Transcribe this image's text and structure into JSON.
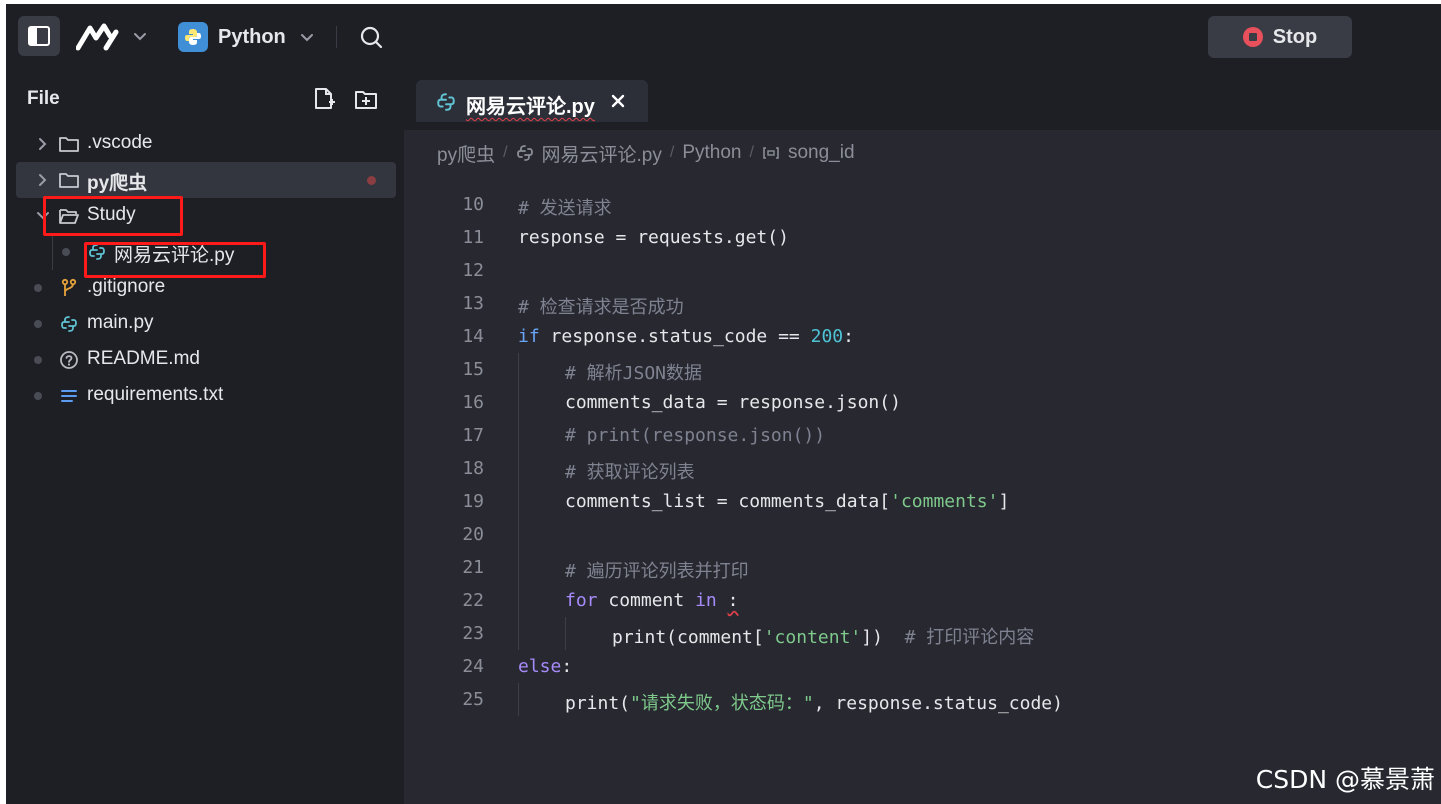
{
  "topbar": {
    "language": "Python",
    "stop_label": "Stop",
    "accent_stop": "#e8505b"
  },
  "sidebar": {
    "title": "File",
    "items": [
      {
        "label": ".vscode",
        "type": "folder",
        "expanded": false
      },
      {
        "label": "py爬虫",
        "type": "folder",
        "expanded": false,
        "active": true,
        "modified": true
      },
      {
        "label": "Study",
        "type": "folder",
        "expanded": true,
        "highlighted": true
      },
      {
        "label": "网易云评论.py",
        "type": "python-file",
        "child": true,
        "highlighted": true
      },
      {
        "label": ".gitignore",
        "type": "git-file"
      },
      {
        "label": "main.py",
        "type": "python-file"
      },
      {
        "label": "README.md",
        "type": "readme-file"
      },
      {
        "label": "requirements.txt",
        "type": "text-file"
      }
    ]
  },
  "editor": {
    "tab_label": "网易云评论.py",
    "breadcrumb": [
      "py爬虫",
      "网易云评论.py",
      "Python",
      "song_id"
    ],
    "lines": [
      {
        "n": "10",
        "text": "# 发送请求"
      },
      {
        "n": "11",
        "text": "response = requests.get()"
      },
      {
        "n": "12",
        "text": ""
      },
      {
        "n": "13",
        "text": "# 检查请求是否成功"
      },
      {
        "n": "14",
        "text": "if response.status_code == 200:"
      },
      {
        "n": "15",
        "text": "# 解析JSON数据"
      },
      {
        "n": "16",
        "text": "comments_data = response.json()"
      },
      {
        "n": "17",
        "text": "# print(response.json())"
      },
      {
        "n": "18",
        "text": "# 获取评论列表"
      },
      {
        "n": "19",
        "text": "comments_list = comments_data['comments']"
      },
      {
        "n": "20",
        "text": ""
      },
      {
        "n": "21",
        "text": "# 遍历评论列表并打印"
      },
      {
        "n": "22",
        "text": "for comment in :"
      },
      {
        "n": "23",
        "text": "print(comment['content'])  # 打印评论内容"
      },
      {
        "n": "24",
        "text": "else:"
      },
      {
        "n": "25",
        "text": "print(\"请求失败，状态码：\", response.status_code)"
      }
    ]
  },
  "watermark": "CSDN @慕景萧"
}
